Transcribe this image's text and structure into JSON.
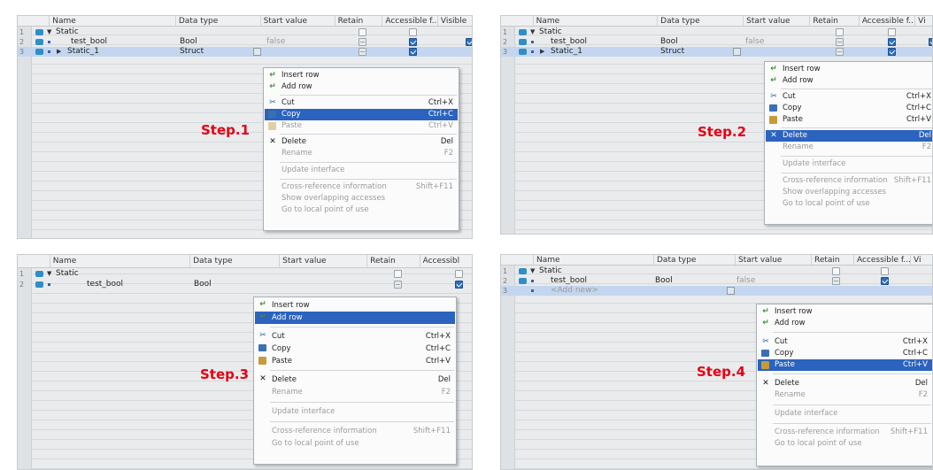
{
  "colors": {
    "step": "#e60012",
    "highlight": "#2b63be",
    "selected_row": "#c4d6ef"
  },
  "panel1": {
    "headers": [
      "Name",
      "Data type",
      "Start value",
      "Retain",
      "Accessible f...",
      "Visible"
    ],
    "rows": [
      {
        "num": "1",
        "name": "Static",
        "type": "",
        "start": ""
      },
      {
        "num": "2",
        "name": "test_bool",
        "type": "Bool",
        "start": "false"
      },
      {
        "num": "3",
        "name": "Static_1",
        "type": "Struct",
        "start": ""
      }
    ],
    "step": "Step.1",
    "menu": {
      "insert_row": "Insert row",
      "add_row": "Add row",
      "cut": "Cut",
      "cut_sc": "Ctrl+X",
      "copy": "Copy",
      "copy_sc": "Ctrl+C",
      "paste": "Paste",
      "paste_sc": "Ctrl+V",
      "delete": "Delete",
      "delete_sc": "Del",
      "rename": "Rename",
      "rename_sc": "F2",
      "update_interface": "Update interface",
      "cross_ref": "Cross-reference information",
      "cross_ref_sc": "Shift+F11",
      "show_overlap": "Show overlapping accesses",
      "goto_local": "Go to local point of use"
    }
  },
  "panel2": {
    "headers": [
      "Name",
      "Data type",
      "Start value",
      "Retain",
      "Accessible f...",
      "Vi"
    ],
    "rows": [
      {
        "num": "1",
        "name": "Static",
        "type": "",
        "start": ""
      },
      {
        "num": "2",
        "name": "test_bool",
        "type": "Bool",
        "start": "false"
      },
      {
        "num": "3",
        "name": "Static_1",
        "type": "Struct",
        "start": ""
      }
    ],
    "step": "Step.2",
    "menu": {
      "insert_row": "Insert row",
      "add_row": "Add row",
      "cut": "Cut",
      "cut_sc": "Ctrl+X",
      "copy": "Copy",
      "copy_sc": "Ctrl+C",
      "paste": "Paste",
      "paste_sc": "Ctrl+V",
      "delete": "Delete",
      "delete_sc": "Del",
      "rename": "Rename",
      "rename_sc": "F2",
      "update_interface": "Update interface",
      "cross_ref": "Cross-reference information",
      "cross_ref_sc": "Shift+F11",
      "show_overlap": "Show overlapping accesses",
      "goto_local": "Go to local point of use"
    }
  },
  "panel3": {
    "headers": [
      "Name",
      "Data type",
      "Start value",
      "Retain",
      "Accessibl"
    ],
    "rows": [
      {
        "num": "1",
        "name": "Static",
        "type": "",
        "start": ""
      },
      {
        "num": "2",
        "name": "test_bool",
        "type": "Bool",
        "start": ""
      }
    ],
    "step": "Step.3",
    "menu": {
      "insert_row": "Insert row",
      "add_row": "Add row",
      "cut": "Cut",
      "cut_sc": "Ctrl+X",
      "copy": "Copy",
      "copy_sc": "Ctrl+C",
      "paste": "Paste",
      "paste_sc": "Ctrl+V",
      "delete": "Delete",
      "delete_sc": "Del",
      "rename": "Rename",
      "rename_sc": "F2",
      "update_interface": "Update interface",
      "cross_ref": "Cross-reference information",
      "cross_ref_sc": "Shift+F11",
      "goto_local": "Go to local point of use"
    }
  },
  "panel4": {
    "headers": [
      "Name",
      "Data type",
      "Start value",
      "Retain",
      "Accessible f...",
      "Vi"
    ],
    "rows": [
      {
        "num": "1",
        "name": "Static",
        "type": "",
        "start": ""
      },
      {
        "num": "2",
        "name": "test_bool",
        "type": "Bool",
        "start": "false"
      },
      {
        "num": "3",
        "name": "<Add new>",
        "type": "",
        "start": ""
      }
    ],
    "step": "Step.4",
    "menu": {
      "insert_row": "Insert row",
      "add_row": "Add row",
      "cut": "Cut",
      "cut_sc": "Ctrl+X",
      "copy": "Copy",
      "copy_sc": "Ctrl+C",
      "paste": "Paste",
      "paste_sc": "Ctrl+V",
      "delete": "Delete",
      "delete_sc": "Del",
      "rename": "Rename",
      "rename_sc": "F2",
      "update_interface": "Update interface",
      "cross_ref": "Cross-reference information",
      "cross_ref_sc": "Shift+F11",
      "goto_local": "Go to local point of use"
    }
  }
}
